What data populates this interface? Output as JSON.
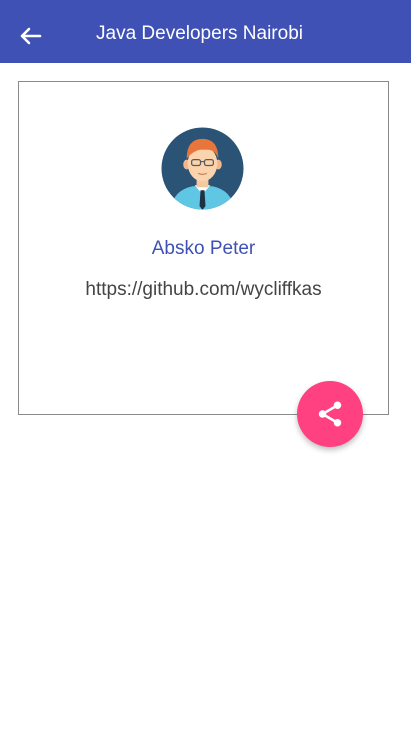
{
  "appbar": {
    "title": "Java Developers Nairobi",
    "back_icon": "arrow-left-icon",
    "color": "#3f51b5"
  },
  "profile": {
    "avatar_icon": "developer-avatar-icon",
    "name": "Absko Peter",
    "url": "https://github.com/wycliffkas"
  },
  "fab": {
    "icon": "share-icon",
    "color": "#ff4081"
  }
}
